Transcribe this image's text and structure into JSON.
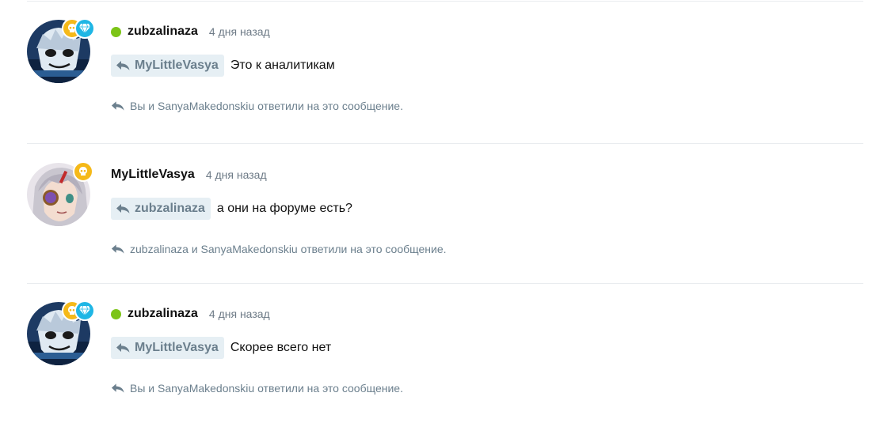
{
  "posts": [
    {
      "author": "zubzalinaza",
      "online": true,
      "time": "4 дня назад",
      "reply_to": "MyLittleVasya",
      "text": "Это к аналитикам",
      "replies_text": "Вы и SanyaMakedonskiu ответили на это сообщение."
    },
    {
      "author": "MyLittleVasya",
      "online": false,
      "time": "4 дня назад",
      "reply_to": "zubzalinaza",
      "text": "а они на форуме есть?",
      "replies_text": "zubzalinaza и SanyaMakedonskiu ответили на это сообщение."
    },
    {
      "author": "zubzalinaza",
      "online": true,
      "time": "4 дня назад",
      "reply_to": "MyLittleVasya",
      "text": "Скорее всего нет",
      "replies_text": "Вы и SanyaMakedonskiu ответили на это сообщение."
    }
  ],
  "colors": {
    "online": "#7cc417",
    "mention_bg": "#e6eff4",
    "muted": "#6b7f8d",
    "badge_skull": "#f5b919",
    "badge_gem": "#1fb6e5"
  },
  "icons": [
    "skull-badge-icon",
    "diamond-badge-icon",
    "reply-arrow-icon"
  ]
}
